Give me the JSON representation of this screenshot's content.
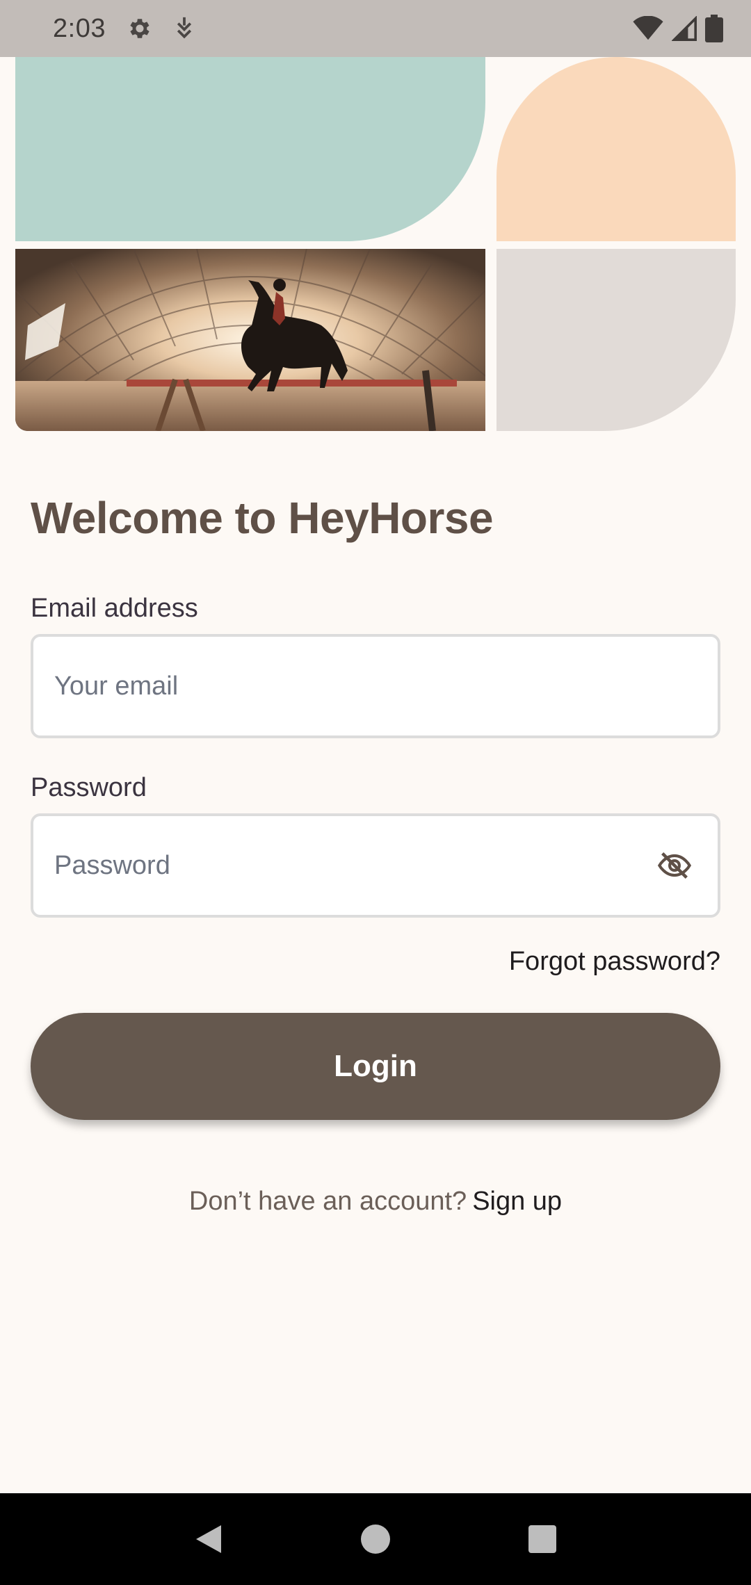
{
  "status_bar": {
    "time": "2:03",
    "icons": [
      "gear-icon",
      "download-icon",
      "wifi-icon",
      "signal-icon",
      "battery-icon"
    ]
  },
  "hero": {
    "colors": {
      "green": "#b5d4cc",
      "peach": "#fad9bb",
      "grey": "#e1dbd7"
    },
    "photo": "horse-jumping-photo"
  },
  "login": {
    "title": "Welcome to HeyHorse",
    "email_label": "Email address",
    "email_placeholder": "Your email",
    "email_value": "",
    "password_label": "Password",
    "password_placeholder": "Password",
    "password_value": "",
    "password_toggle_icon": "eye-off-icon",
    "forgot_password": "Forgot password?",
    "login_button": "Login",
    "signup_prompt": "Don’t have an account?",
    "signup_link": "Sign up"
  },
  "theme": {
    "primary": "#65584e",
    "background": "#fdf9f5"
  },
  "nav_bar": {
    "icons": [
      "back-icon",
      "home-icon",
      "recents-icon"
    ]
  }
}
